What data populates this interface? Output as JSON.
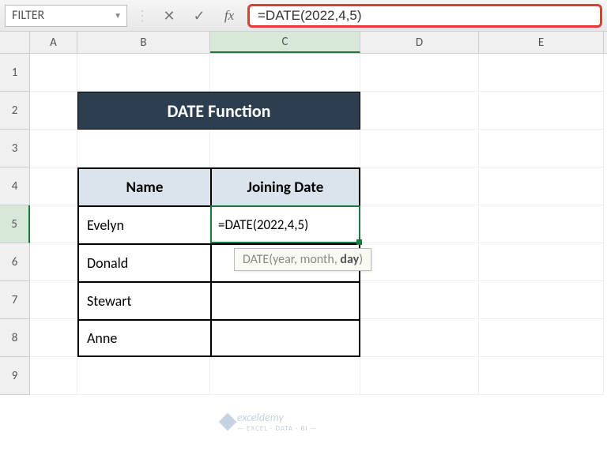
{
  "formula_bar": {
    "name_box": "FILTER",
    "formula": "=DATE(2022,4,5)"
  },
  "columns": [
    "A",
    "B",
    "C",
    "D",
    "E"
  ],
  "rows": [
    "1",
    "2",
    "3",
    "4",
    "5",
    "6",
    "7",
    "8",
    "9"
  ],
  "title": "DATE Function",
  "table": {
    "headers": {
      "name": "Name",
      "date": "Joining Date"
    },
    "rows": [
      {
        "name": "Evelyn",
        "date": "=DATE(2022,4,5)"
      },
      {
        "name": "Donald",
        "date": ""
      },
      {
        "name": "Stewart",
        "date": ""
      },
      {
        "name": "Anne",
        "date": ""
      }
    ]
  },
  "tooltip": {
    "fn": "DATE",
    "args_pre": "(year, month, ",
    "arg_bold": "day",
    "args_post": ")"
  },
  "watermark": {
    "name": "exceldemy",
    "sub": "— EXCEL · DATA · BI —"
  }
}
